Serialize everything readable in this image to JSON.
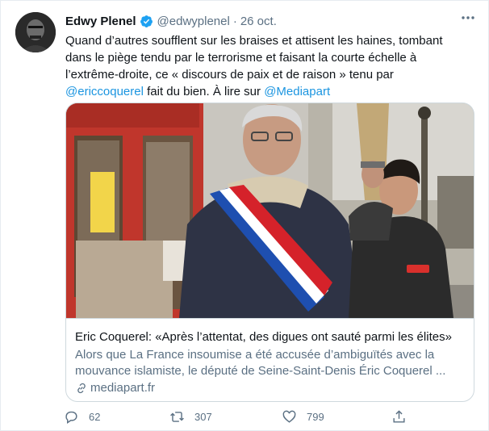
{
  "tweet": {
    "author_name": "Edwy Plenel",
    "handle": "@edwyplenel",
    "separator": "·",
    "date": "26 oct.",
    "text_part1": "Quand d’autres soufflent sur les braises et attisent les haines, tombant dans le piège tendu par le terrorisme et faisant la courte échelle à l’extrême-droite, ce « discours de paix et de raison » tenu par ",
    "mention1": "@ericcoquerel",
    "text_part2": " fait du bien. À lire sur ",
    "mention2": "@Mediapart"
  },
  "card": {
    "title": "Eric Coquerel: «Après l’attentat, des digues ont sauté parmi les élites»",
    "description": "Alors que La France insoumise a été accusée d’ambiguïtés avec la mouvance islamiste, le député de Seine-Saint-Denis Éric Coquerel ...",
    "domain": "mediapart.fr"
  },
  "actions": {
    "replies": "62",
    "retweets": "307",
    "likes": "799"
  },
  "colors": {
    "link": "#1b95e0",
    "secondary_text": "#5b7083",
    "verified": "#1da1f2"
  },
  "icons": [
    "verified-badge-icon",
    "more-icon",
    "link-icon",
    "reply-icon",
    "retweet-icon",
    "like-icon",
    "share-icon"
  ]
}
